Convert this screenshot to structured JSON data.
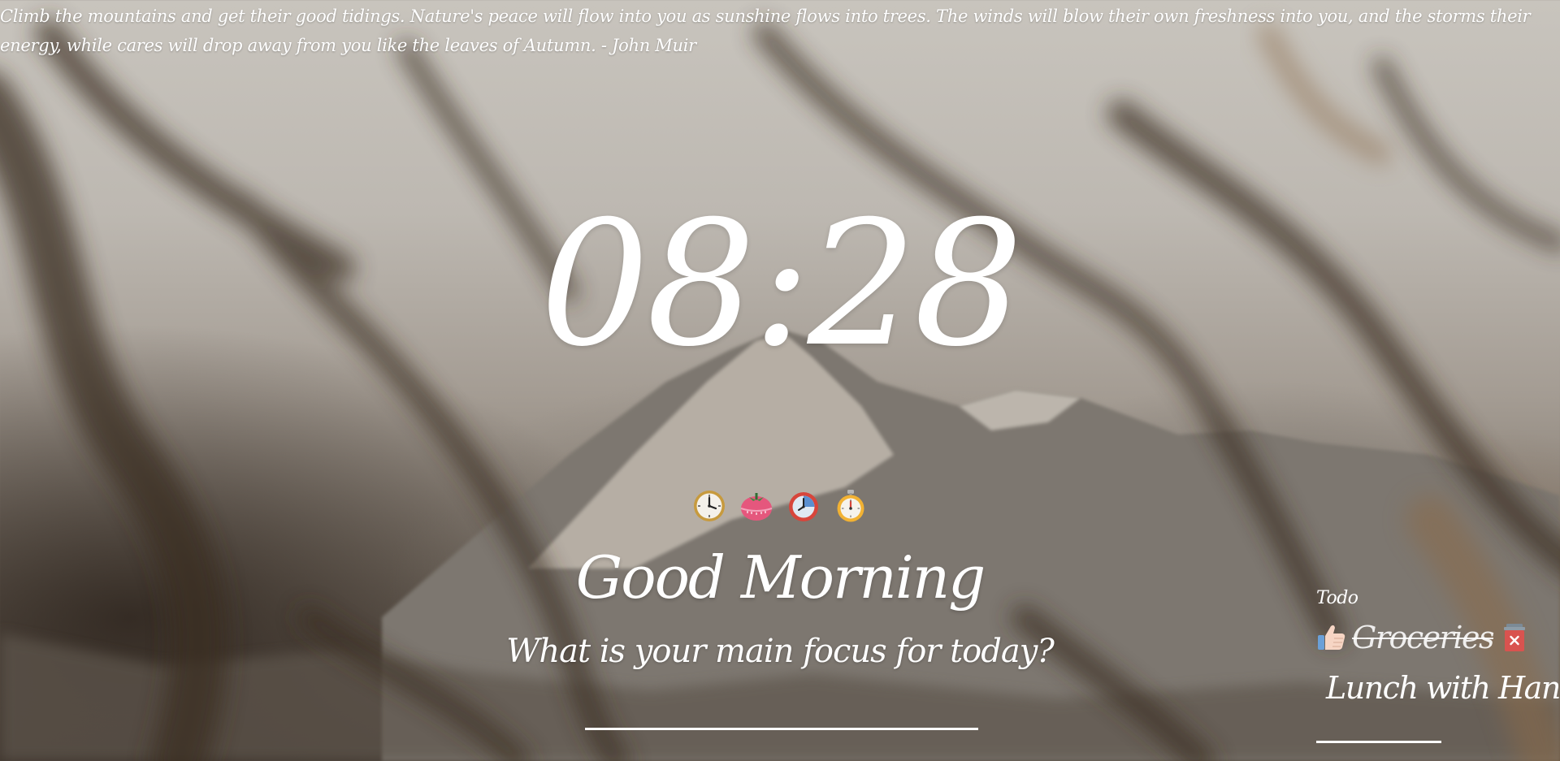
{
  "quote": {
    "text": "Climb the mountains and get their good tidings. Nature's peace will flow into you as sunshine flows into trees. The winds will blow their own freshness into you, and the storms their energy, while cares will drop away from you like the leaves of Autumn. - John Muir"
  },
  "clock": {
    "time": "08:28"
  },
  "modes": [
    {
      "name": "clock",
      "icon": "analog-clock-icon"
    },
    {
      "name": "pomodoro",
      "icon": "tomato-timer-icon"
    },
    {
      "name": "timer",
      "icon": "timer-clock-icon"
    },
    {
      "name": "stopwatch",
      "icon": "stopwatch-icon"
    }
  ],
  "greeting": {
    "text": "Good Morning"
  },
  "focus": {
    "prompt": "What is your main focus for today?",
    "value": ""
  },
  "todo": {
    "title": "Todo",
    "items": [
      {
        "text": "Groceries",
        "done": true,
        "status_icon": "thumbs-up-icon",
        "delete_icon": "trash-delete-icon"
      },
      {
        "text": "Lunch with Hank",
        "done": false,
        "status_icon": "checkbox-icon",
        "delete_icon": "trash-delete-icon"
      }
    ],
    "new_item_value": ""
  },
  "colors": {
    "text": "#ffffff",
    "delete_red": "#d9534f"
  }
}
